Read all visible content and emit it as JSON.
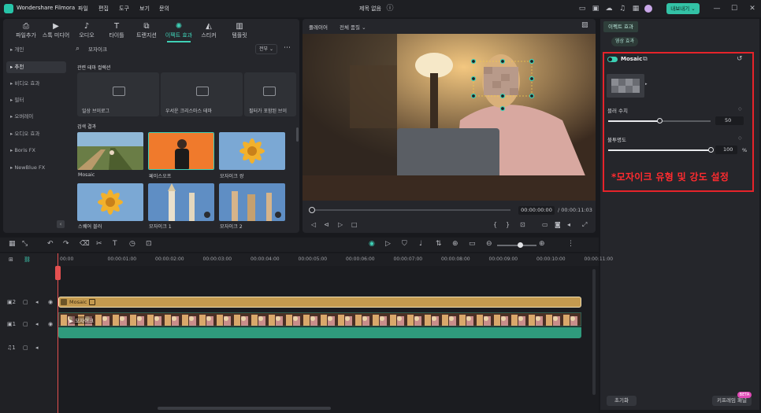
{
  "app": {
    "name": "Wondershare Filmora",
    "title": "제목 없음",
    "export_label": "내보내기"
  },
  "menu": [
    "파일",
    "편집",
    "도구",
    "보기",
    "문의"
  ],
  "toolbar_tabs": [
    {
      "label": "파일추가",
      "icon": "upload-icon"
    },
    {
      "label": "스톡 미디어",
      "icon": "stock-media-icon"
    },
    {
      "label": "오디오",
      "icon": "music-note-icon"
    },
    {
      "label": "타이틀",
      "icon": "title-t-icon"
    },
    {
      "label": "트랜지션",
      "icon": "transition-icon"
    },
    {
      "label": "이펙트 효과",
      "icon": "effects-sparkle-icon"
    },
    {
      "label": "스티커",
      "icon": "sticker-icon"
    },
    {
      "label": "템플릿",
      "icon": "template-icon"
    }
  ],
  "sidebar": [
    "개인",
    "추천",
    "비디오 효과",
    "필터",
    "오버레이",
    "오디오 효과",
    "Boris FX",
    "NewBlue FX"
  ],
  "search": {
    "value": "모자이크",
    "filter": "전부"
  },
  "sections": {
    "recommended": "관련 테마 컬렉션",
    "results": "검색 결과"
  },
  "recommended_cards": [
    "일상 브이로그",
    "우서운 크리스마스 테마",
    "필터가 포함된 브이"
  ],
  "effects": [
    {
      "label": "Mosaic"
    },
    {
      "label": "페이스오프"
    },
    {
      "label": "모자이크 쌍"
    },
    {
      "label": "스퀘어 블러"
    },
    {
      "label": "모자이크 1"
    },
    {
      "label": "모자이크 2"
    }
  ],
  "player": {
    "label": "플레이어",
    "quality": "전체 품질",
    "current_time": "00:00:00:00",
    "total_time": "/ 00:00:11:03",
    "progress": 0
  },
  "right_panel": {
    "tab": "이펙트 효과",
    "subtab": "영상 효과",
    "effect_name": "Mosaic",
    "blur_label": "블러 수치",
    "blur_value": "50",
    "blur_value_num": 50,
    "opacity_label": "불투명도",
    "opacity_value": "100",
    "opacity_value_num": 100,
    "opacity_unit": "%",
    "note": "*모자이크 유형 및 강도 설정",
    "reset_label": "초기화",
    "keyframe_label": "키프레임 패널",
    "beta_label": "BETA"
  },
  "timeline": {
    "ticks": [
      "00:00",
      "00:00:01:00",
      "00:00:02:00",
      "00:00:03:00",
      "00:00:04:00",
      "00:00:05:00",
      "00:00:06:00",
      "00:00:07:00",
      "00:00:08:00",
      "00:00:09:00",
      "00:00:10:00",
      "00:00:11:00"
    ],
    "effect_clip": "Mosaic",
    "video_clip": "모자이크",
    "track_numbers": [
      "2",
      "1",
      "1"
    ]
  },
  "colors": {
    "accent": "#3fd0b6",
    "highlight": "#e6232a",
    "note": "#ff2b2f",
    "effect_clip": "#c49a4f",
    "audio_clip": "#2f9a7c"
  }
}
